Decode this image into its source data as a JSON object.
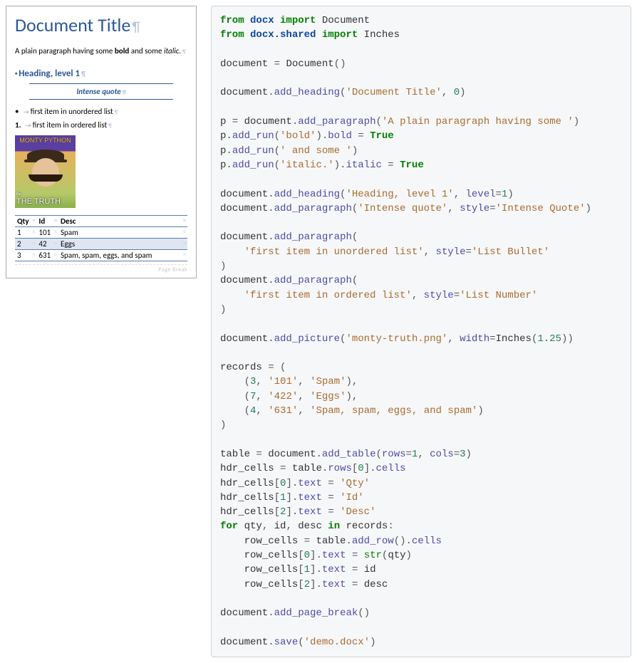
{
  "doc": {
    "title": "Document Title",
    "para_plain": "A plain paragraph having some ",
    "para_bold": "bold",
    "para_mid": " and some ",
    "para_italic": "italic.",
    "h1": "Heading, level 1",
    "intense_quote": "Intense quote",
    "bullet_item": "first item in unordered list",
    "number_item": "first item in ordered list",
    "number_item_num": "1.",
    "pic_logo": "MONTY PYTHON",
    "pic_truth_pre": "the",
    "pic_truth": "THE TRUTH",
    "table_headers": [
      "Qty",
      "Id",
      "Desc"
    ],
    "table_rows": [
      [
        "1",
        "101",
        "Spam"
      ],
      [
        "2",
        "42",
        "Eggs"
      ],
      [
        "3",
        "631",
        "Spam, spam, eggs, and spam"
      ]
    ],
    "page_break_label": "Page Break"
  },
  "code": {
    "kw_from1": "from",
    "mod_docx": "docx",
    "kw_import1": "import",
    "name_Document": "Document",
    "kw_from2": "from",
    "mod_docx_shared": "docx.shared",
    "kw_import2": "import",
    "name_Inches": "Inches",
    "n_document": "document",
    "op_eq": " = ",
    "call_Document": "Document",
    "lp": "(",
    "rp": ")",
    "m_add_heading": "add_heading",
    "s_doc_title": "'Document Title'",
    "num_0": "0",
    "n_p": "p",
    "m_add_paragraph": "add_paragraph",
    "s_plain": "'A plain paragraph having some '",
    "m_add_run": "add_run",
    "s_bold": "'bold'",
    "attr_bold": "bold",
    "kw_True": "True",
    "s_and_some": "' and some '",
    "s_italic": "'italic.'",
    "attr_italic": "italic",
    "s_h1": "'Heading, level 1'",
    "kw_level": "level",
    "num_1": "1",
    "s_iq": "'Intense quote'",
    "kw_style": "style",
    "s_style_iq": "'Intense Quote'",
    "s_ul": "'first item in unordered list'",
    "s_style_lb": "'List Bullet'",
    "s_ol": "'first item in ordered list'",
    "s_style_ln": "'List Number'",
    "m_add_picture": "add_picture",
    "s_pic": "'monty-truth.png'",
    "kw_width": "width",
    "num_125": "1.25",
    "n_records": "records",
    "num_3": "3",
    "s_101": "'101'",
    "s_spam": "'Spam'",
    "num_7": "7",
    "s_422": "'422'",
    "s_eggs": "'Eggs'",
    "num_4": "4",
    "s_631": "'631'",
    "s_ssens": "'Spam, spam, eggs, and spam'",
    "n_table": "table",
    "m_add_table": "add_table",
    "kw_rows": "rows",
    "kw_cols": "cols",
    "n_hdr_cells": "hdr_cells",
    "attr_rows": "rows",
    "idx0": "0",
    "idx1": "1",
    "idx2": "2",
    "attr_cells": "cells",
    "attr_text": "text",
    "s_qty": "'Qty'",
    "s_id": "'Id'",
    "s_desc": "'Desc'",
    "kw_for": "for",
    "n_qty": "qty",
    "n_id": "id",
    "n_desc": "desc",
    "kw_in": "in",
    "n_row_cells": "row_cells",
    "m_add_row": "add_row",
    "bi_str": "str",
    "m_add_page_break": "add_page_break",
    "m_save": "save",
    "s_demo": "'demo.docx'",
    "dot": ".",
    "comma": ", ",
    "colon": ":",
    "lb": "[",
    "rb": "]"
  }
}
